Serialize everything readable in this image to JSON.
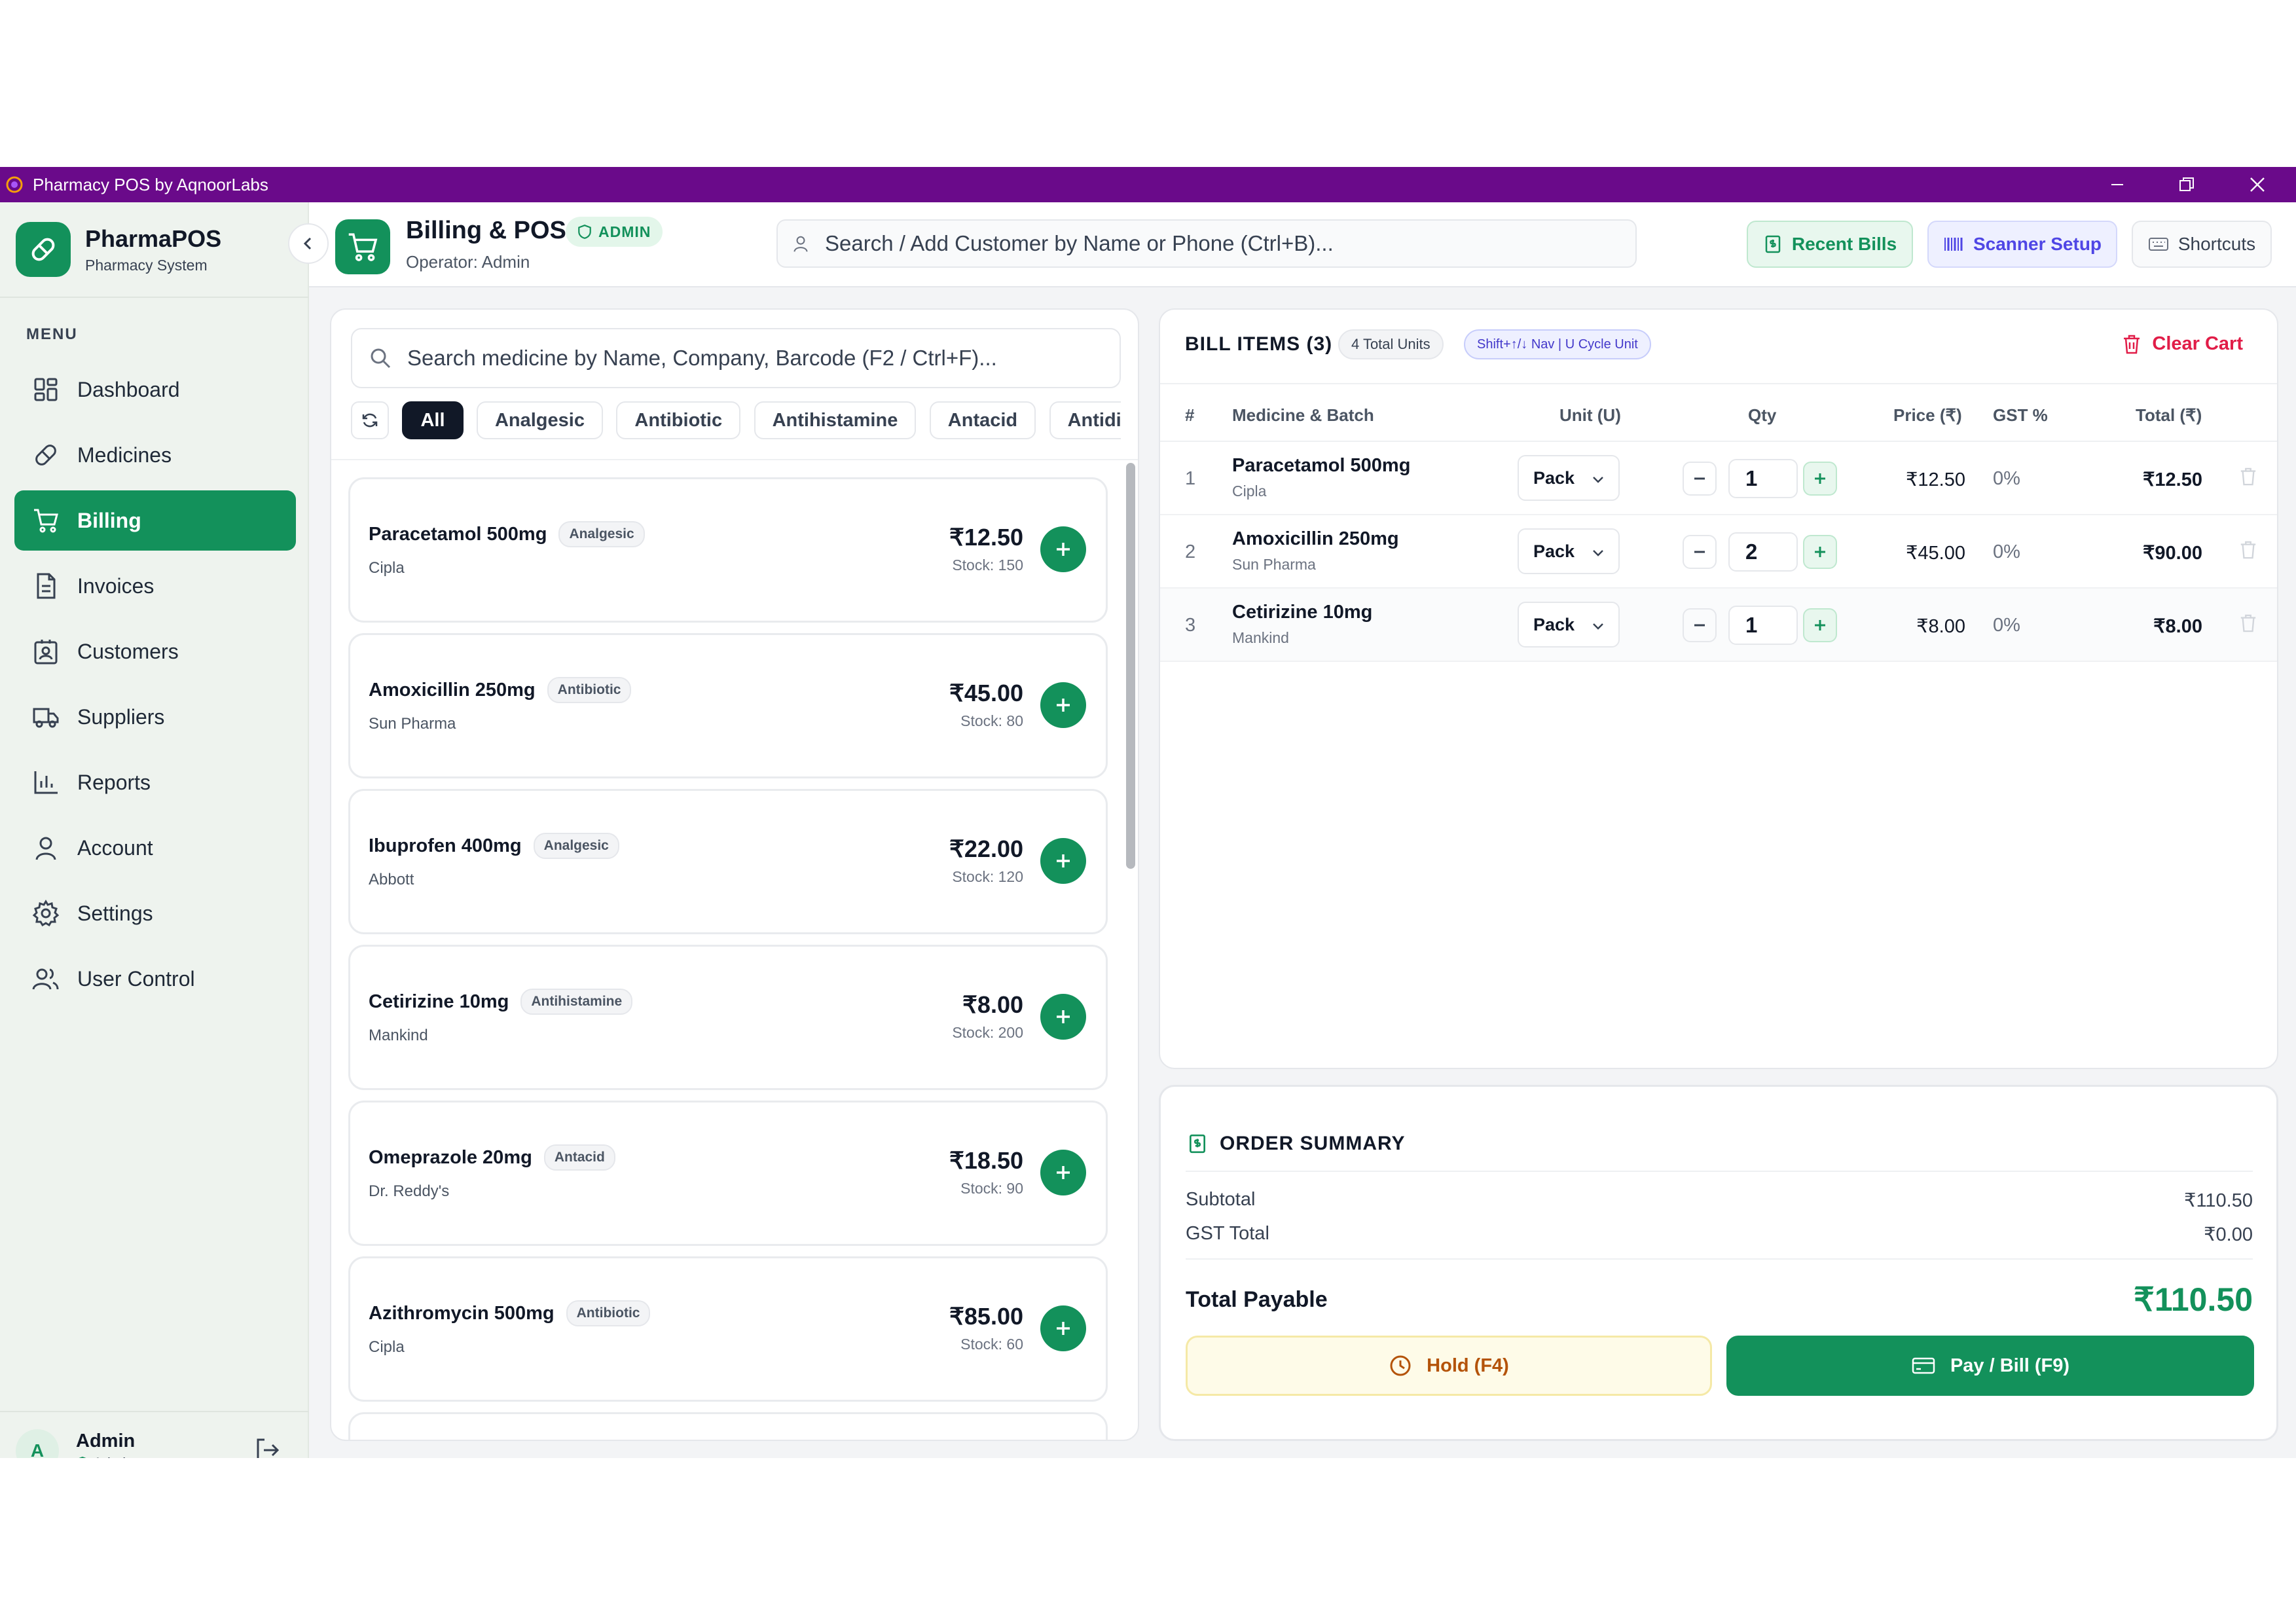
{
  "window": {
    "title": "Pharmacy POS by AqnoorLabs"
  },
  "brand": {
    "name": "PharmaPOS",
    "subtitle": "Pharmacy System"
  },
  "sidebar": {
    "menu_label": "MENU",
    "items": [
      {
        "label": "Dashboard",
        "icon": "dashboard-icon"
      },
      {
        "label": "Medicines",
        "icon": "pill-icon"
      },
      {
        "label": "Billing",
        "icon": "cart-icon",
        "active": true
      },
      {
        "label": "Invoices",
        "icon": "document-icon"
      },
      {
        "label": "Customers",
        "icon": "contact-card-icon"
      },
      {
        "label": "Suppliers",
        "icon": "truck-icon"
      },
      {
        "label": "Reports",
        "icon": "bar-chart-icon"
      },
      {
        "label": "Account",
        "icon": "user-icon"
      },
      {
        "label": "Settings",
        "icon": "gear-icon"
      },
      {
        "label": "User Control",
        "icon": "users-icon"
      }
    ],
    "user": {
      "initial": "A",
      "name": "Admin",
      "role": "Admin"
    }
  },
  "header": {
    "title": "Billing & POS",
    "badge": "ADMIN",
    "operator": "Operator: Admin",
    "customer_search_placeholder": "Search / Add Customer by Name or Phone (Ctrl+B)...",
    "buttons": {
      "recent": "Recent Bills",
      "scanner": "Scanner Setup",
      "shortcuts": "Shortcuts"
    }
  },
  "catalog": {
    "search_placeholder": "Search medicine by Name, Company, Barcode (F2 / Ctrl+F)...",
    "categories": [
      "All",
      "Analgesic",
      "Antibiotic",
      "Antihistamine",
      "Antacid",
      "Antidiab"
    ],
    "active_category": "All",
    "medicines": [
      {
        "name": "Paracetamol 500mg",
        "category": "Analgesic",
        "company": "Cipla",
        "price": "₹12.50",
        "stock": "Stock: 150"
      },
      {
        "name": "Amoxicillin 250mg",
        "category": "Antibiotic",
        "company": "Sun Pharma",
        "price": "₹45.00",
        "stock": "Stock: 80"
      },
      {
        "name": "Ibuprofen 400mg",
        "category": "Analgesic",
        "company": "Abbott",
        "price": "₹22.00",
        "stock": "Stock: 120"
      },
      {
        "name": "Cetirizine 10mg",
        "category": "Antihistamine",
        "company": "Mankind",
        "price": "₹8.00",
        "stock": "Stock: 200"
      },
      {
        "name": "Omeprazole 20mg",
        "category": "Antacid",
        "company": "Dr. Reddy's",
        "price": "₹18.50",
        "stock": "Stock: 90"
      },
      {
        "name": "Azithromycin 500mg",
        "category": "Antibiotic",
        "company": "Cipla",
        "price": "₹85.00",
        "stock": "Stock: 60"
      }
    ]
  },
  "bill": {
    "title": "BILL ITEMS (3)",
    "units_badge": "4 Total Units",
    "nav_badge": "Shift+↑/↓ Nav | U Cycle Unit",
    "clear_label": "Clear Cart",
    "columns": {
      "num": "#",
      "medicine": "Medicine & Batch",
      "unit": "Unit (U)",
      "qty": "Qty",
      "price": "Price (₹)",
      "gst": "GST %",
      "total": "Total (₹)"
    },
    "items": [
      {
        "num": "1",
        "name": "Paracetamol 500mg",
        "company": "Cipla",
        "unit": "Pack",
        "qty": "1",
        "price": "₹12.50",
        "gst": "0%",
        "total": "₹12.50"
      },
      {
        "num": "2",
        "name": "Amoxicillin 250mg",
        "company": "Sun Pharma",
        "unit": "Pack",
        "qty": "2",
        "price": "₹45.00",
        "gst": "0%",
        "total": "₹90.00"
      },
      {
        "num": "3",
        "name": "Cetirizine 10mg",
        "company": "Mankind",
        "unit": "Pack",
        "qty": "1",
        "price": "₹8.00",
        "gst": "0%",
        "total": "₹8.00"
      }
    ]
  },
  "summary": {
    "title": "ORDER SUMMARY",
    "subtotal_label": "Subtotal",
    "subtotal": "₹110.50",
    "gst_label": "GST Total",
    "gst": "₹0.00",
    "total_label": "Total Payable",
    "total": "₹110.50",
    "hold_label": "Hold (F4)",
    "pay_label": "Pay / Bill (F9)"
  },
  "colors": {
    "accent": "#13915b",
    "titlebar": "#6a0a8a",
    "danger": "#e11d48",
    "scanner": "#4f46e5"
  }
}
